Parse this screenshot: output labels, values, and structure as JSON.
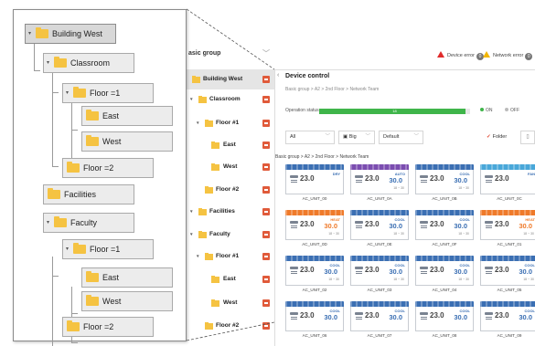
{
  "zoom_tree": [
    {
      "label": "Building West",
      "toggle": "▾",
      "selected": true
    },
    {
      "label": "Classroom",
      "toggle": "▾"
    },
    {
      "label": "Floor =1",
      "toggle": "▾"
    },
    {
      "label": "East"
    },
    {
      "label": "West"
    },
    {
      "label": "Floor =2"
    },
    {
      "label": "Facilities"
    },
    {
      "label": "Faculty",
      "toggle": "▾"
    },
    {
      "label": "Floor =1",
      "toggle": "▾"
    },
    {
      "label": "East"
    },
    {
      "label": "West"
    },
    {
      "label": "Floor =2"
    }
  ],
  "side": {
    "group_label": "asic group",
    "items": [
      {
        "label": "Building West",
        "selected": true
      },
      {
        "label": "Classroom",
        "toggle": "▾"
      },
      {
        "label": "Floor #1",
        "toggle": "▾"
      },
      {
        "label": "East"
      },
      {
        "label": "West"
      },
      {
        "label": "Floor #2"
      },
      {
        "label": "Facilities",
        "toggle": "▾"
      },
      {
        "label": "Faculty",
        "toggle": "▾"
      },
      {
        "label": "Floor #1",
        "toggle": "▾"
      },
      {
        "label": "East"
      },
      {
        "label": "West"
      },
      {
        "label": "Floor #2"
      }
    ]
  },
  "alerts": {
    "device_error": "Device error",
    "device_error_count": "0",
    "network_error": "Network error",
    "network_error_count": "0"
  },
  "device_control": {
    "title": "Device control",
    "breadcrumb": "Basic group  >  A2  >  2nd Floor  >  Network Team",
    "operation_label": "Operation status",
    "operation_value": "18",
    "operation_fraction": 0.97,
    "on_label": "ON",
    "off_label": "OFF"
  },
  "filters": {
    "all": "All",
    "big": "Big",
    "default": "Default",
    "folder": "Folder"
  },
  "grid_breadcrumb": "Basic group > A2 > 2nd Floor > Network Team",
  "colors": {
    "cool": "#3b6fb3",
    "heat": "#ef7a2a",
    "auto": "#7b4db0",
    "fan": "#49a7d9",
    "error": "#e02b2b",
    "warning": "#f2b600",
    "on": "#3fb54a"
  },
  "units": [
    {
      "name": "AC_UNIT_00",
      "mode": "dry",
      "mode_label": "DRY",
      "room": "23.0",
      "set": "",
      "range": ""
    },
    {
      "name": "AC_UNIT_0A",
      "mode": "auto",
      "mode_label": "AUTO",
      "room": "23.0",
      "set": "30.0",
      "range": "18 ~ 30"
    },
    {
      "name": "AC_UNIT_0B",
      "mode": "cool",
      "mode_label": "COOL",
      "room": "23.0",
      "set": "30.0",
      "range": "18 ~ 30"
    },
    {
      "name": "AC_UNIT_0C",
      "mode": "fan",
      "mode_label": "FAN",
      "room": "23.0",
      "set": "",
      "range": ""
    },
    {
      "name": "AC_UNIT_0D",
      "mode": "heat",
      "mode_label": "HEAT",
      "room": "23.0",
      "set": "30.0",
      "range": "18 ~ 30"
    },
    {
      "name": "AC_UNIT_0E",
      "mode": "cool",
      "mode_label": "COOL",
      "room": "23.0",
      "set": "30.0",
      "range": "18 ~ 30"
    },
    {
      "name": "AC_UNIT_0F",
      "mode": "cool",
      "mode_label": "COOL",
      "room": "23.0",
      "set": "30.0",
      "range": "18 ~ 30"
    },
    {
      "name": "AC_UNIT_01",
      "mode": "heat",
      "mode_label": "HEAT",
      "room": "23.0",
      "set": "30.0",
      "range": "18 ~ 30"
    },
    {
      "name": "AC_UNIT_02",
      "mode": "cool",
      "mode_label": "COOL",
      "room": "23.0",
      "set": "30.0",
      "range": "18 ~ 30"
    },
    {
      "name": "AC_UNIT_03",
      "mode": "cool",
      "mode_label": "COOL",
      "room": "23.0",
      "set": "30.0",
      "range": "18 ~ 30"
    },
    {
      "name": "AC_UNIT_04",
      "mode": "cool",
      "mode_label": "COOL",
      "room": "23.0",
      "set": "30.0",
      "range": "18 ~ 30"
    },
    {
      "name": "AC_UNIT_05",
      "mode": "cool",
      "mode_label": "COOL",
      "room": "23.0",
      "set": "30.0",
      "range": "18 ~ 30"
    },
    {
      "name": "AC_UNIT_06",
      "mode": "cool",
      "mode_label": "COOL",
      "room": "23.0",
      "set": "30.0",
      "range": ""
    },
    {
      "name": "AC_UNIT_07",
      "mode": "cool",
      "mode_label": "COOL",
      "room": "23.0",
      "set": "30.0",
      "range": ""
    },
    {
      "name": "AC_UNIT_08",
      "mode": "cool",
      "mode_label": "COOL",
      "room": "23.0",
      "set": "30.0",
      "range": ""
    },
    {
      "name": "AC_UNIT_09",
      "mode": "cool",
      "mode_label": "COOL",
      "room": "23.0",
      "set": "30.0",
      "range": ""
    }
  ]
}
